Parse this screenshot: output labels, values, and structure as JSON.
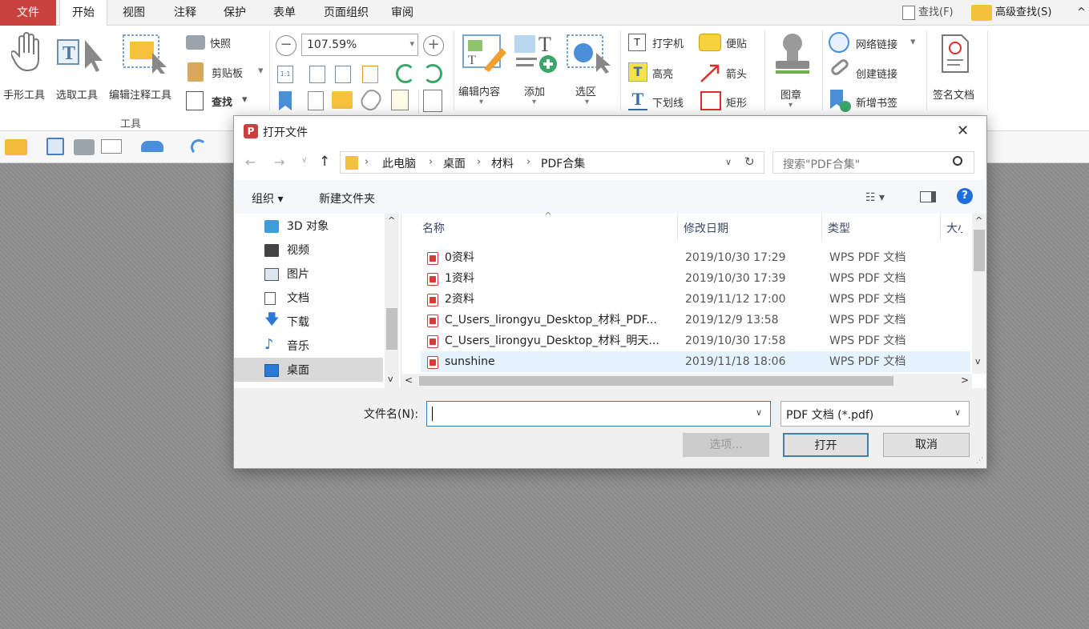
{
  "menubar": {
    "file": "文件",
    "tabs": [
      "开始",
      "视图",
      "注释",
      "保护",
      "表单",
      "页面组织",
      "审阅"
    ],
    "find": "查找(F)",
    "advanced_find": "高级查找(S)",
    "collapse": "^"
  },
  "ribbon": {
    "hand_tool": "手形工具",
    "select_tool": "选取工具",
    "edit_annot_tool": "编辑注释工具",
    "group_tools": "工具",
    "snapshot": "快照",
    "clipboard": "剪贴板",
    "find": "查找",
    "zoom_value": "107.59%",
    "edit_content": "编辑内容",
    "add": "添加",
    "select_area": "选区",
    "typewriter": "打字机",
    "note": "便贴",
    "highlight": "高亮",
    "arrow": "箭头",
    "underline": "下划线",
    "rectangle": "矩形",
    "stamp": "图章",
    "web_link": "网络链接",
    "create_link": "创建链接",
    "new_bookmark": "新增书签",
    "sign_doc": "签名文档"
  },
  "dialog": {
    "title": "打开文件",
    "close": "✕",
    "breadcrumb": [
      "此电脑",
      "桌面",
      "材料",
      "PDF合集"
    ],
    "search_placeholder": "搜索\"PDF合集\"",
    "organize": "组织 ▾",
    "new_folder": "新建文件夹",
    "nav": [
      "3D 对象",
      "视频",
      "图片",
      "文档",
      "下载",
      "音乐",
      "桌面"
    ],
    "columns": {
      "name": "名称",
      "date": "修改日期",
      "type": "类型",
      "size": "大小"
    },
    "files": [
      {
        "name": "0资料",
        "date": "2019/10/30 17:29",
        "type": "WPS PDF 文档"
      },
      {
        "name": "1资料",
        "date": "2019/10/30 17:39",
        "type": "WPS PDF 文档"
      },
      {
        "name": "2资料",
        "date": "2019/11/12 17:00",
        "type": "WPS PDF 文档"
      },
      {
        "name": "C_Users_lirongyu_Desktop_材料_PDF...",
        "date": "2019/12/9 13:58",
        "type": "WPS PDF 文档"
      },
      {
        "name": "C_Users_lirongyu_Desktop_材料_明天...",
        "date": "2019/10/30 17:58",
        "type": "WPS PDF 文档"
      },
      {
        "name": "sunshine",
        "date": "2019/11/18 18:06",
        "type": "WPS PDF 文档"
      }
    ],
    "filename_label": "文件名(N):",
    "filename_value": "",
    "filetype": "PDF 文档 (*.pdf)",
    "options": "选项...",
    "open": "打开",
    "cancel": "取消"
  },
  "colors": {
    "accent": "#c8413f",
    "selected_row": "#e5f3ff",
    "nav_selected": "#d9d9d9"
  }
}
